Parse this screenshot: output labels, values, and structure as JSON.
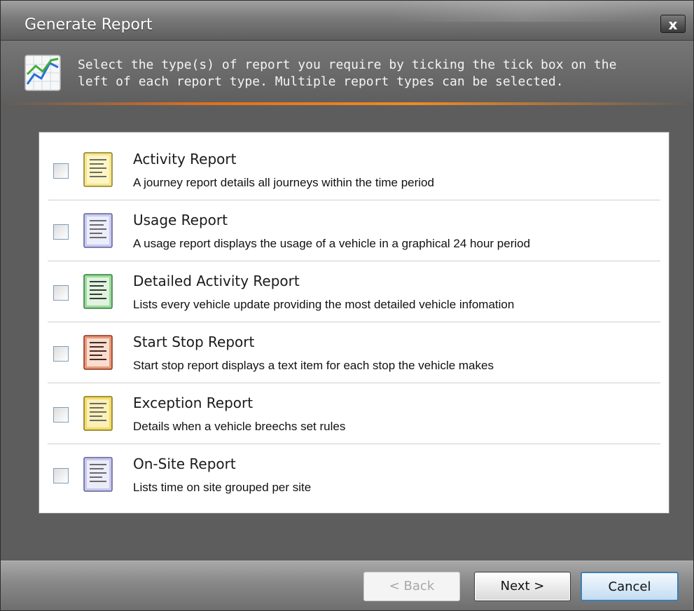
{
  "window": {
    "title": "Generate Report",
    "close_label": "x"
  },
  "banner": {
    "icon": "line-chart-icon",
    "text_line1": "Select the type(s) of report you require by ticking the tick box on the",
    "text_line2": "left of each report type. Multiple report types can be selected."
  },
  "reports": [
    {
      "title": "Activity Report",
      "description": "A journey report details all journeys within the time period",
      "checked": false,
      "icon": "report-document-icon",
      "color": "#e8c830"
    },
    {
      "title": "Usage Report",
      "description": "A usage report displays the usage of a vehicle in a graphical 24 hour period",
      "checked": false,
      "icon": "report-document-icon",
      "color": "#8a8fd0"
    },
    {
      "title": "Detailed Activity Report",
      "description": "Lists every vehicle update providing the most detailed vehicle infomation",
      "checked": false,
      "icon": "report-document-icon",
      "color": "#3ea84a"
    },
    {
      "title": "Start Stop Report",
      "description": "Start stop report displays a text item for each stop the vehicle makes",
      "checked": false,
      "icon": "report-document-icon",
      "color": "#cc4a26"
    },
    {
      "title": "Exception Report",
      "description": "Details when a vehicle breechs set rules",
      "checked": false,
      "icon": "report-document-icon",
      "color": "#e2c128"
    },
    {
      "title": "On-Site Report",
      "description": "Lists time on site grouped per site",
      "checked": false,
      "icon": "report-document-icon",
      "color": "#8c8fc8"
    }
  ],
  "buttons": {
    "back_label": "< Back",
    "back_enabled": false,
    "next_label": "Next >",
    "cancel_label": "Cancel"
  },
  "colors": {
    "accent_rule": "#f08a24",
    "cancel_border": "#3c7fb1"
  }
}
